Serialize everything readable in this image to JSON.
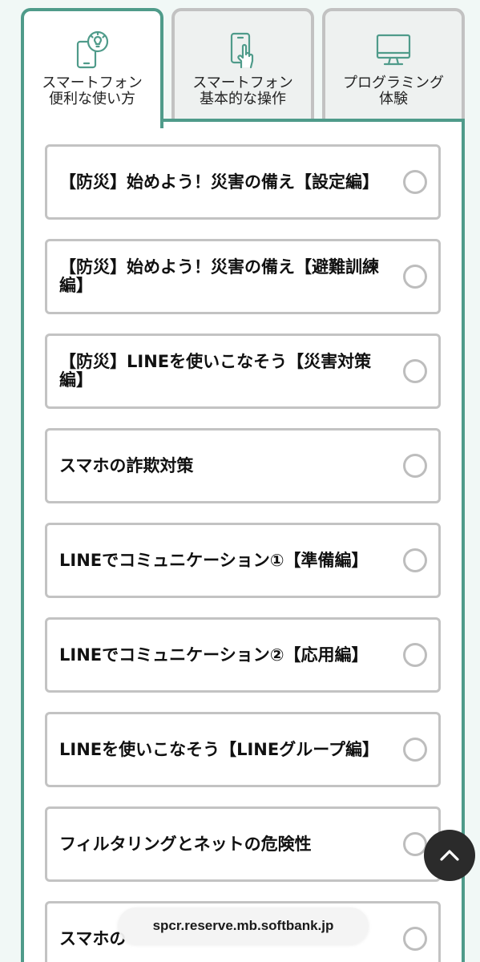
{
  "tabs": [
    {
      "label": "スマートフォン\n便利な使い方",
      "icon": "phone-lightbulb-icon",
      "active": true
    },
    {
      "label": "スマートフォン\n基本的な操作",
      "icon": "phone-tap-icon",
      "active": false
    },
    {
      "label": "プログラミング\n体験",
      "icon": "monitor-icon",
      "active": false
    }
  ],
  "items": [
    {
      "label": "【防災】始めよう！災害の備え【設定編】"
    },
    {
      "label": "【防災】始めよう！災害の備え【避難訓練編】"
    },
    {
      "label": "【防災】LINEを使いこなそう【災害対策編】"
    },
    {
      "label": "スマホの詐欺対策"
    },
    {
      "label": "LINEでコミュニケーション①【準備編】"
    },
    {
      "label": "LINEでコミュニケーション②【応用編】"
    },
    {
      "label": "LINEを使いこなそう【LINEグループ編】"
    },
    {
      "label": "フィルタリングとネットの危険性"
    },
    {
      "label": "スマホの"
    }
  ],
  "browser": {
    "url": "spcr.reserve.mb.softbank.jp"
  },
  "colors": {
    "accent": "#4f9b8a",
    "border": "#c3c3c3",
    "background": "#f1f8f6"
  },
  "icons": {
    "back_to_top": "chevron-up-icon"
  }
}
